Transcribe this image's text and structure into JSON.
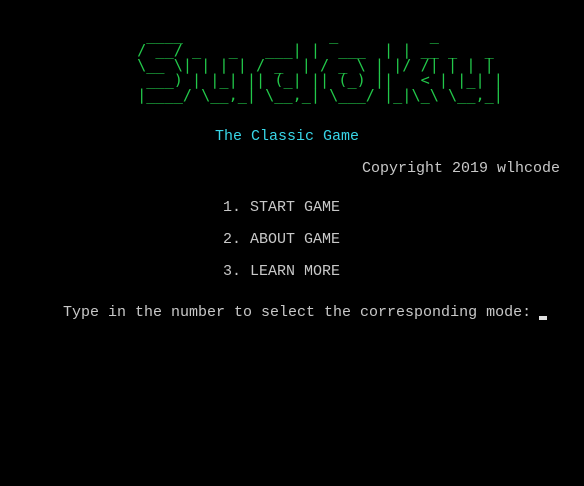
{
  "logo": {
    "text": "Sudoku",
    "color": "#22c84a"
  },
  "subtitle": "The Classic Game",
  "copyright": "Copyright 2019 wlhcode",
  "menu": {
    "items": [
      {
        "label": "1. START GAME"
      },
      {
        "label": "2. ABOUT GAME"
      },
      {
        "label": "3. LEARN MORE"
      }
    ]
  },
  "prompt": {
    "text": "Type in the number to select the corresponding mode:",
    "input_value": ""
  },
  "colors": {
    "background": "#000000",
    "logo": "#22c84a",
    "subtitle": "#38d6e8",
    "text": "#c8c8c8"
  }
}
